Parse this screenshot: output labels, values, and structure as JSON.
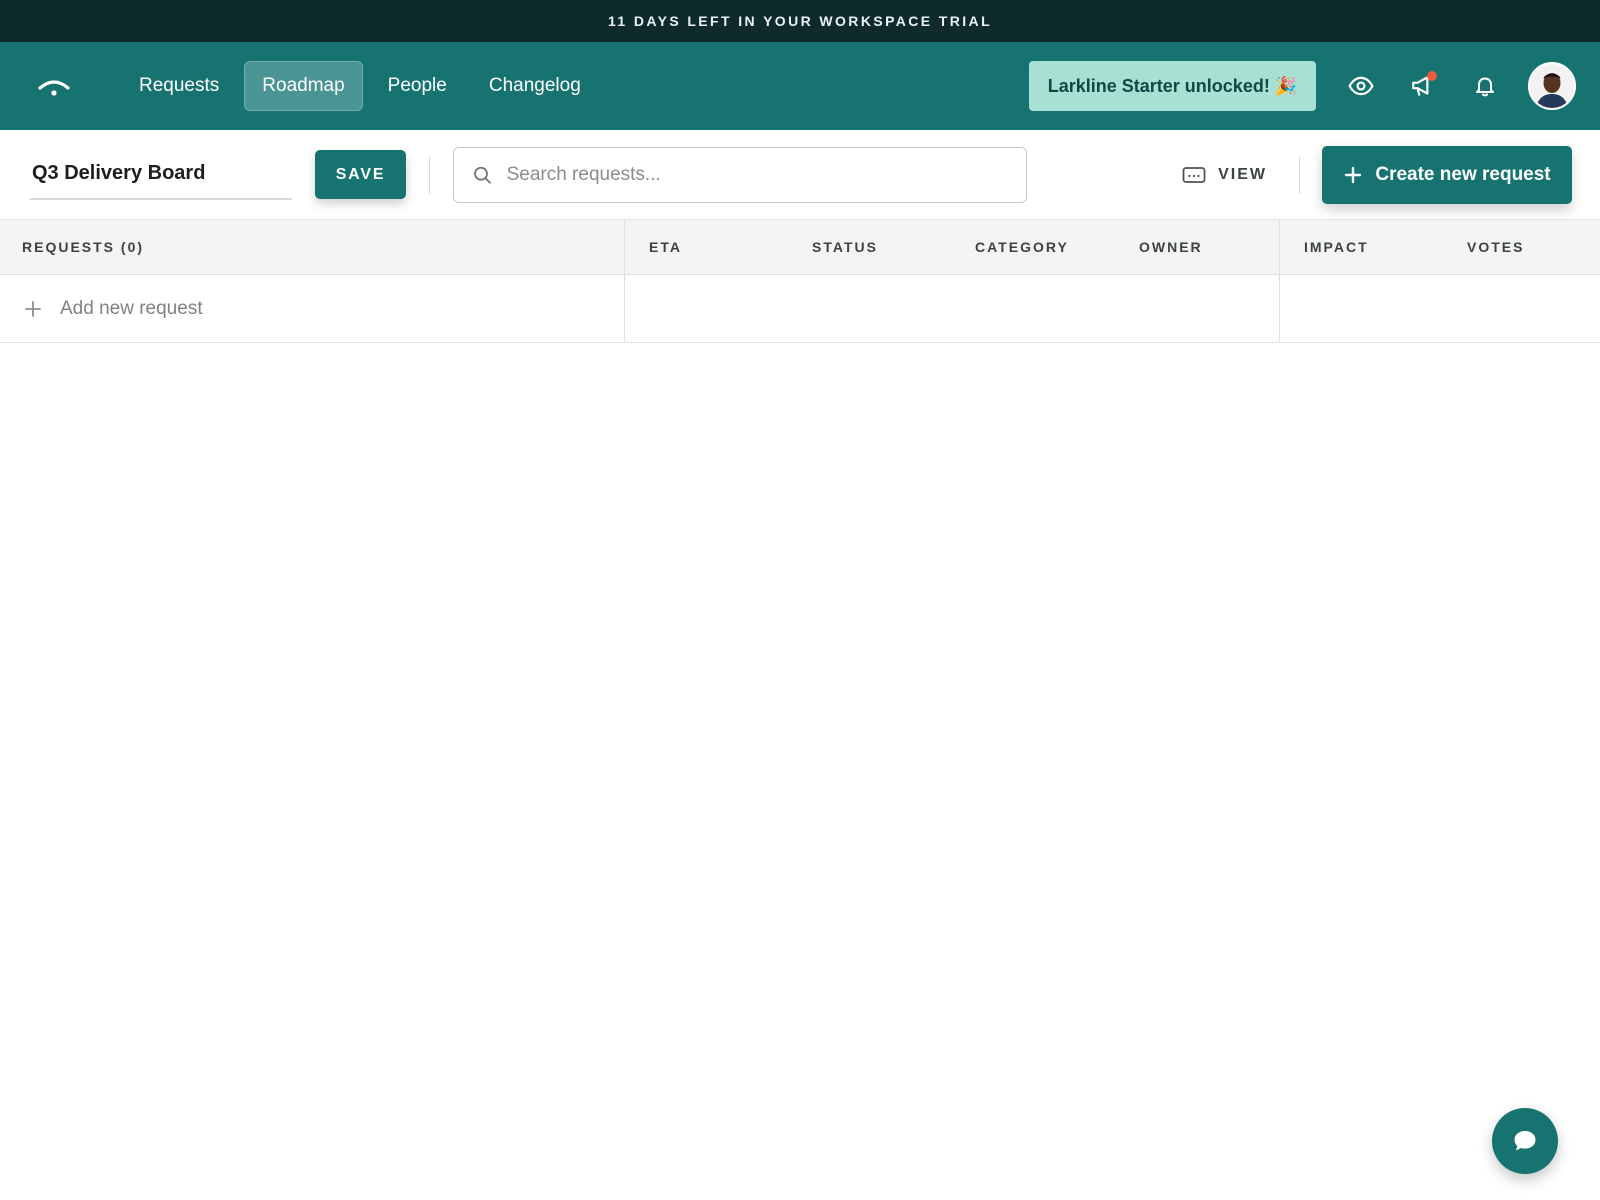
{
  "trial_banner": {
    "text": "11 DAYS LEFT IN YOUR WORKSPACE TRIAL"
  },
  "nav": {
    "logo_icon": "wifi-arc-logo",
    "links": [
      {
        "label": "Requests",
        "active": false
      },
      {
        "label": "Roadmap",
        "active": true
      },
      {
        "label": "People",
        "active": false
      },
      {
        "label": "Changelog",
        "active": false
      }
    ],
    "promo_label": "Larkline Starter unlocked! 🎉",
    "icons": [
      "eye-icon",
      "megaphone-icon",
      "bell-icon"
    ],
    "avatar_icon": "user-avatar"
  },
  "toolbar": {
    "board_title": "Q3 Delivery Board",
    "save_label": "SAVE",
    "search_placeholder": "Search requests...",
    "view_label": "VIEW",
    "create_label": "Create new request"
  },
  "table": {
    "columns": {
      "requests": "REQUESTS (0)",
      "eta": "ETA",
      "status": "STATUS",
      "category": "CATEGORY",
      "owner": "OWNER",
      "impact": "IMPACT",
      "votes": "VOTES"
    },
    "add_row_label": "Add new request"
  },
  "colors": {
    "primary": "#167370",
    "banner": "#0f2a2c",
    "promo": "#a8e0d3",
    "notification_dot": "#e85c43"
  }
}
